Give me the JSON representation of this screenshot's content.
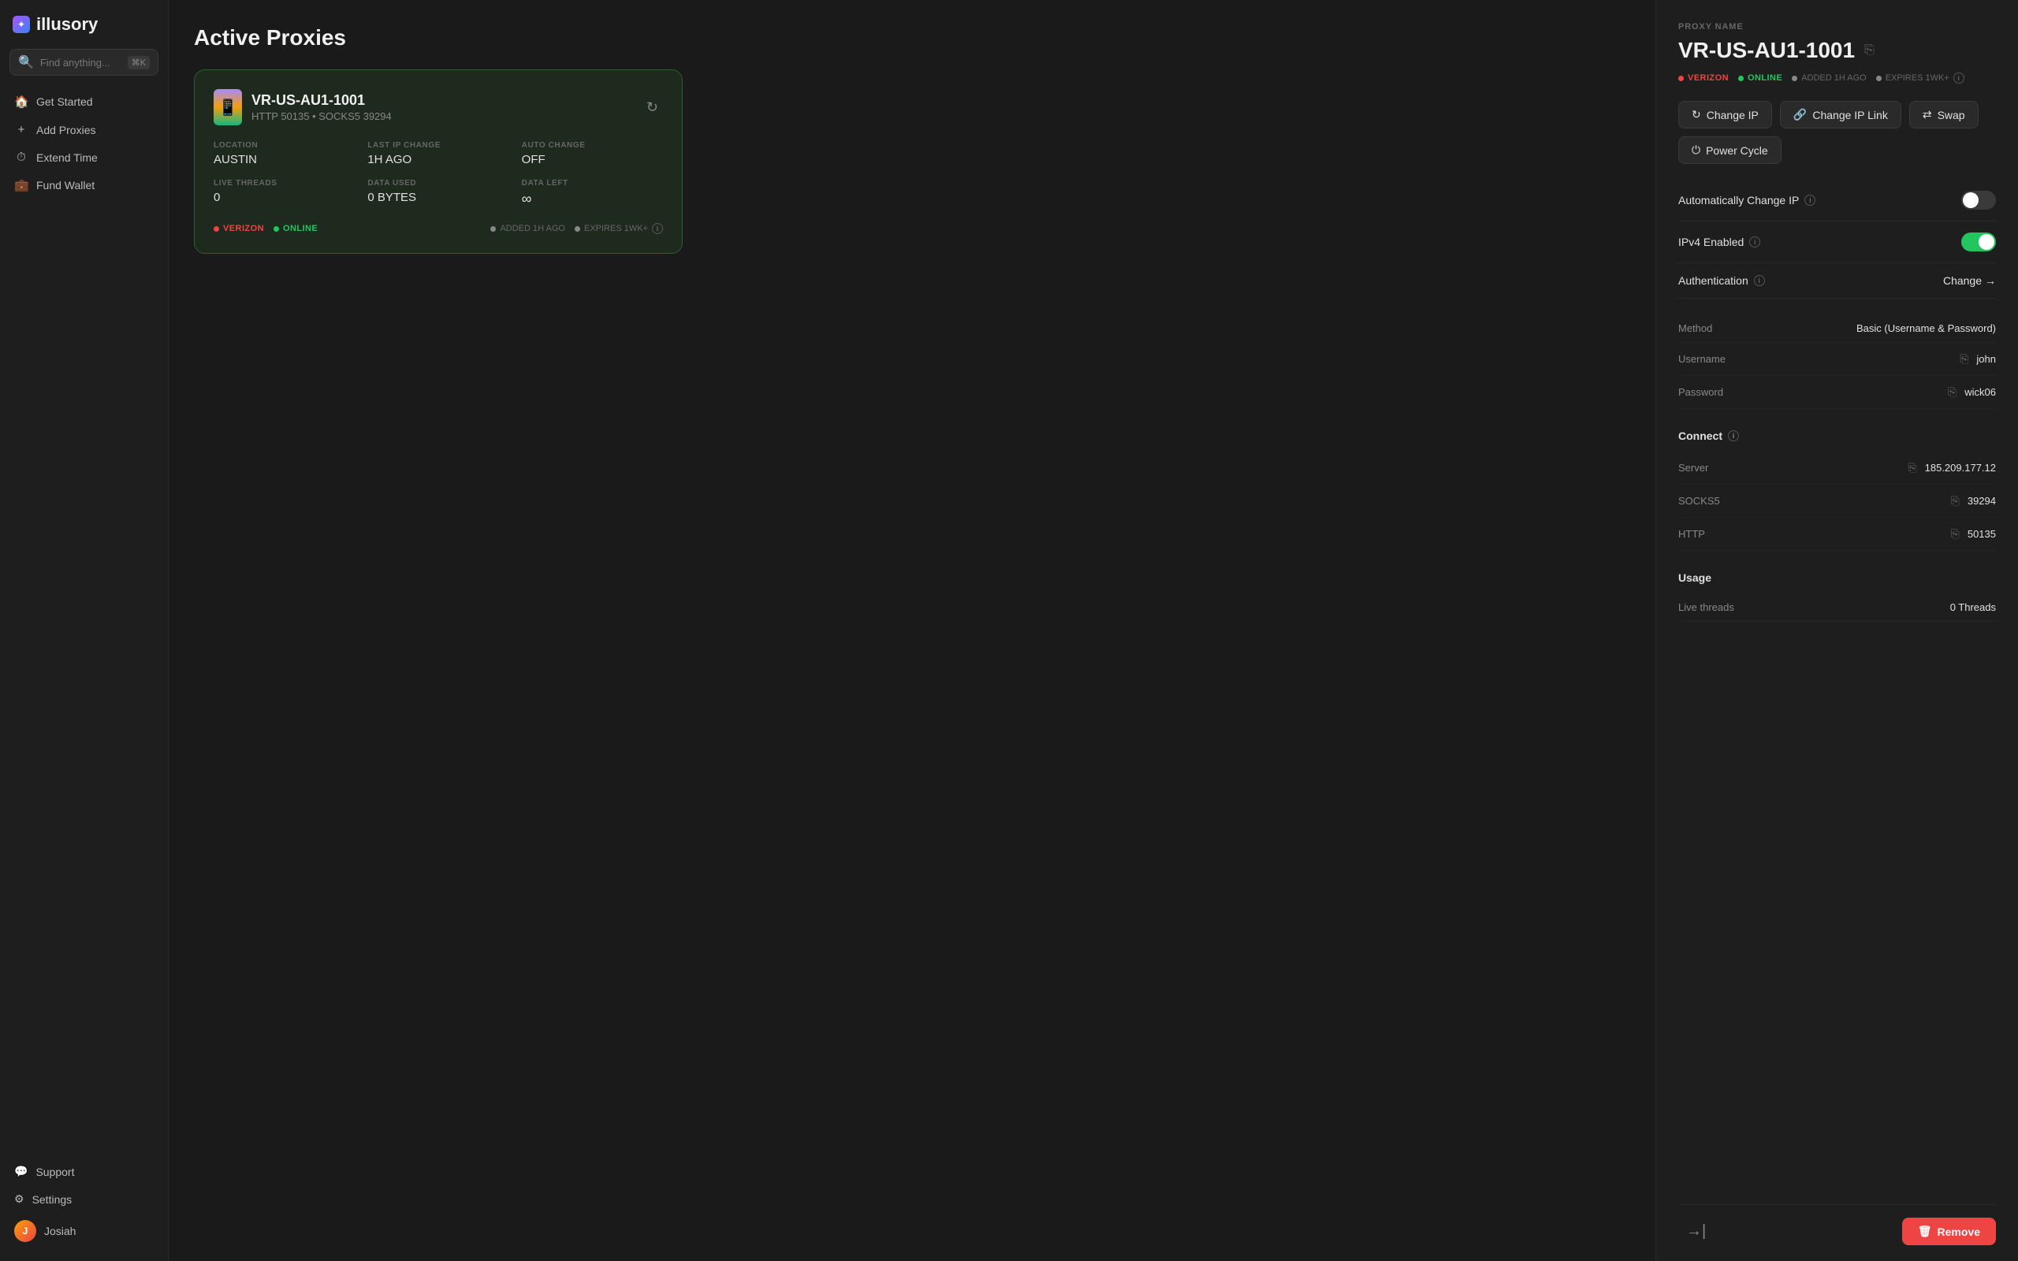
{
  "app": {
    "name": "illusory"
  },
  "search": {
    "placeholder": "Find anything...",
    "shortcut": "⌘K"
  },
  "sidebar": {
    "nav_items": [
      {
        "id": "get-started",
        "label": "Get Started",
        "icon": "🏠"
      },
      {
        "id": "add-proxies",
        "label": "Add Proxies",
        "icon": "+"
      },
      {
        "id": "extend-time",
        "label": "Extend Time",
        "icon": "⏱"
      },
      {
        "id": "fund-wallet",
        "label": "Fund Wallet",
        "icon": "💼"
      }
    ],
    "footer_items": [
      {
        "id": "support",
        "label": "Support",
        "icon": "💬"
      },
      {
        "id": "settings",
        "label": "Settings",
        "icon": "⚙"
      }
    ],
    "user": {
      "name": "Josiah",
      "initials": "J"
    }
  },
  "main": {
    "page_title": "Active Proxies",
    "proxy_card": {
      "name": "VR-US-AU1-1001",
      "protocols": "HTTP 50135 • SOCKS5 39294",
      "location_label": "LOCATION",
      "location_value": "AUSTIN",
      "last_ip_change_label": "LAST IP CHANGE",
      "last_ip_change_value": "1H AGO",
      "auto_change_label": "AUTO CHANGE",
      "auto_change_value": "OFF",
      "live_threads_label": "LIVE THREADS",
      "live_threads_value": "0",
      "data_used_label": "DATA USED",
      "data_used_value": "0 BYTES",
      "data_left_label": "DATA LEFT",
      "data_left_value": "∞",
      "badges": {
        "carrier": "VERIZON",
        "status": "ONLINE",
        "added": "ADDED 1H AGO",
        "expires": "EXPIRES 1WK+"
      }
    }
  },
  "panel": {
    "proxy_name_label": "PROXY NAME",
    "proxy_name": "VR-US-AU1-1001",
    "badges": {
      "carrier": "VERIZON",
      "status": "ONLINE",
      "added": "ADDED 1H AGO",
      "expires": "EXPIRES 1WK+"
    },
    "buttons": {
      "change_ip": "Change IP",
      "change_ip_link": "Change IP Link",
      "swap": "Swap",
      "power_cycle": "Power Cycle"
    },
    "settings": {
      "auto_change_ip_label": "Automatically Change IP",
      "ipv4_enabled_label": "IPv4 Enabled",
      "authentication_label": "Authentication",
      "authentication_change": "Change",
      "method_label": "Method",
      "method_value": "Basic (Username & Password)",
      "username_label": "Username",
      "username_value": "john",
      "password_label": "Password",
      "password_value": "wick06"
    },
    "connect": {
      "section_label": "Connect",
      "server_label": "Server",
      "server_value": "185.209.177.12",
      "socks5_label": "SOCKS5",
      "socks5_value": "39294",
      "http_label": "HTTP",
      "http_value": "50135"
    },
    "usage": {
      "section_label": "Usage",
      "live_threads_label": "Live threads",
      "live_threads_value": "0 Threads"
    },
    "footer": {
      "remove_label": "Remove"
    }
  }
}
